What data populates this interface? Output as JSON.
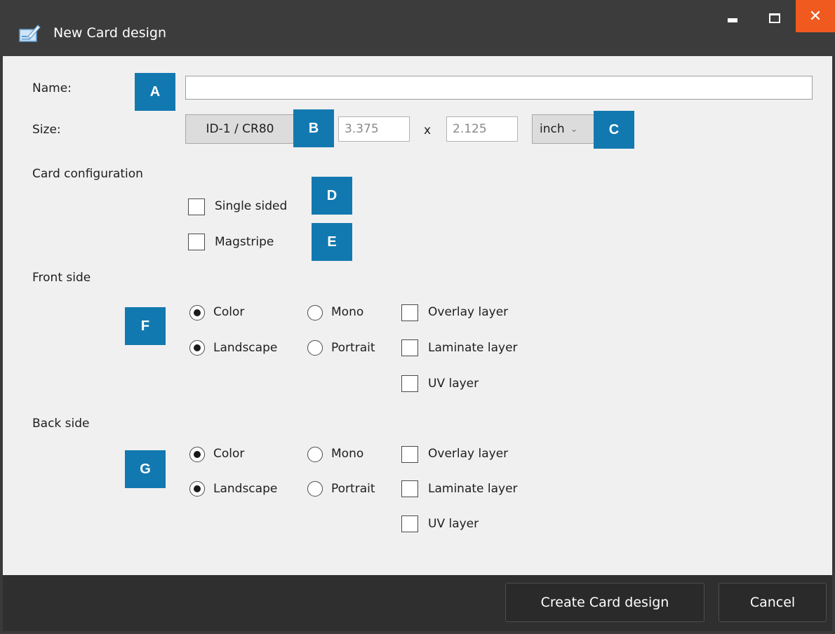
{
  "window": {
    "title": "New Card design",
    "close_glyph": "✕"
  },
  "form": {
    "name_label": "Name:",
    "name_value": "",
    "size_label": "Size:",
    "size_preset": "ID-1 / CR80",
    "width_value": "3.375",
    "times": "x",
    "height_value": "2.125",
    "unit": "inch",
    "unit_chevron": "⌄",
    "card_config_label": "Card configuration",
    "single_sided": "Single sided",
    "magstripe": "Magstripe"
  },
  "front": {
    "label": "Front side",
    "color": "Color",
    "mono": "Mono",
    "landscape": "Landscape",
    "portrait": "Portrait",
    "overlay": "Overlay layer",
    "laminate": "Laminate layer",
    "uv": "UV layer"
  },
  "back": {
    "label": "Back side",
    "color": "Color",
    "mono": "Mono",
    "landscape": "Landscape",
    "portrait": "Portrait",
    "overlay": "Overlay layer",
    "laminate": "Laminate layer",
    "uv": "UV layer"
  },
  "markers": {
    "a": "A",
    "b": "B",
    "c": "C",
    "d": "D",
    "e": "E",
    "f": "F",
    "g": "G"
  },
  "footer": {
    "create": "Create Card design",
    "cancel": "Cancel"
  },
  "colors": {
    "marker": "#1279b0",
    "close": "#f05a1e",
    "titlebar": "#3c3c3c"
  },
  "icons": [
    "card-design-icon",
    "minimize-icon",
    "maximize-icon",
    "close-icon",
    "chevron-down-icon"
  ]
}
